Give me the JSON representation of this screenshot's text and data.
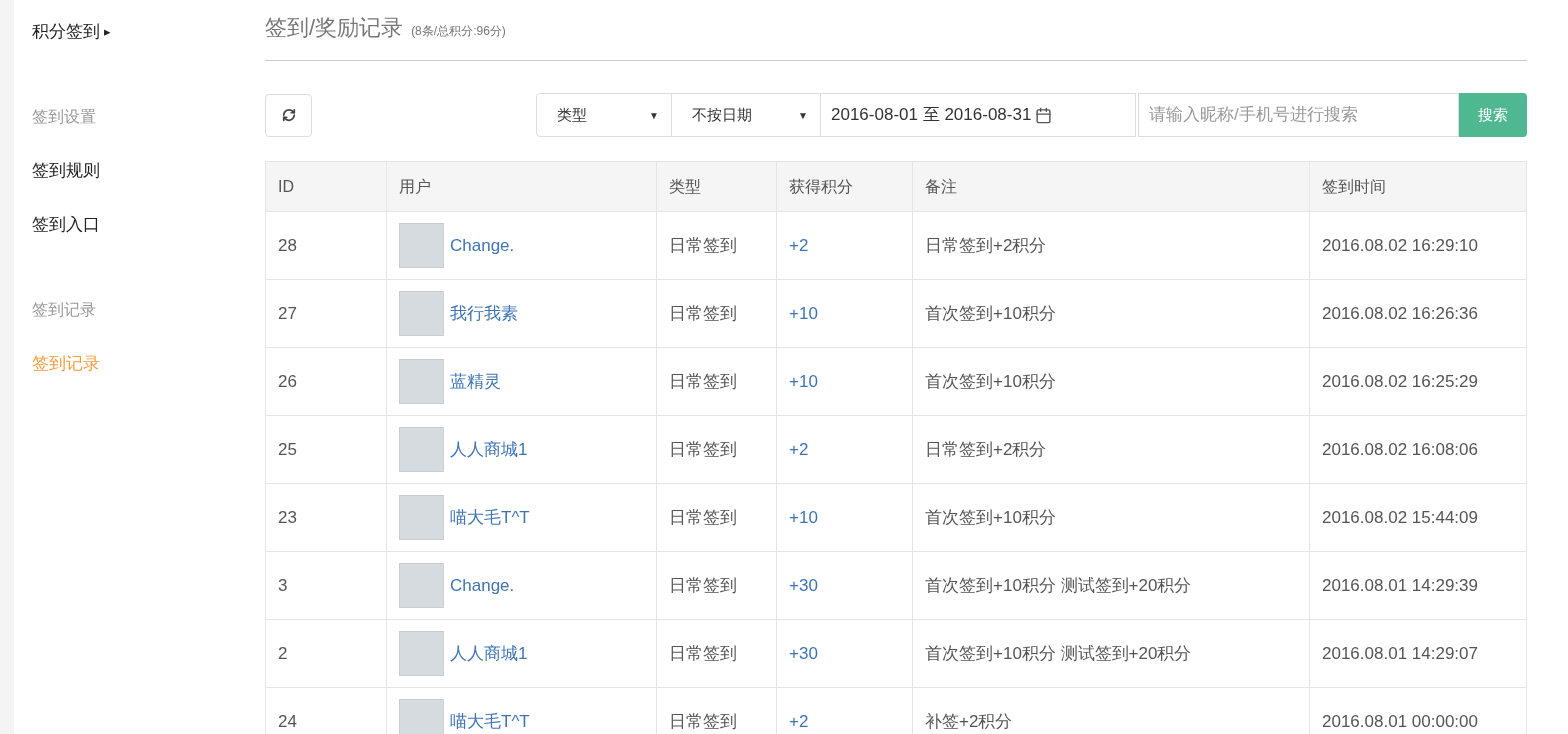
{
  "sidebar": {
    "title": "积分签到",
    "title_icon": "▸",
    "groups": [
      {
        "label": "签到设置",
        "items": [
          {
            "label": "签到规则",
            "selected": false
          },
          {
            "label": "签到入口",
            "selected": false
          }
        ]
      },
      {
        "label": "签到记录",
        "items": [
          {
            "label": "签到记录",
            "selected": true
          }
        ]
      }
    ]
  },
  "page": {
    "title": "签到/奖励记录",
    "summary": "(8条/总积分:96分)"
  },
  "toolbar": {
    "type_select": "类型",
    "type_caret": "▼",
    "date_select": "不按日期",
    "date_caret": "▼",
    "date_range": "2016-08-01 至 2016-08-31",
    "search": {
      "placeholder": "请输入昵称/手机号进行搜索"
    },
    "search_button": "搜索"
  },
  "table": {
    "columns": [
      "ID",
      "用户",
      "类型",
      "获得积分",
      "备注",
      "签到时间"
    ],
    "rows": [
      {
        "id": "28",
        "user": "Change.",
        "type": "日常签到",
        "points": "+2",
        "note": "日常签到+2积分",
        "time": "2016.08.02 16:29:10"
      },
      {
        "id": "27",
        "user": "我行我素",
        "type": "日常签到",
        "points": "+10",
        "note": "首次签到+10积分",
        "time": "2016.08.02 16:26:36"
      },
      {
        "id": "26",
        "user": "蓝精灵",
        "type": "日常签到",
        "points": "+10",
        "note": "首次签到+10积分",
        "time": "2016.08.02 16:25:29"
      },
      {
        "id": "25",
        "user": "人人商城1",
        "type": "日常签到",
        "points": "+2",
        "note": "日常签到+2积分",
        "time": "2016.08.02 16:08:06"
      },
      {
        "id": "23",
        "user": "喵大毛T^T",
        "type": "日常签到",
        "points": "+10",
        "note": "首次签到+10积分",
        "time": "2016.08.02 15:44:09"
      },
      {
        "id": "3",
        "user": "Change.",
        "type": "日常签到",
        "points": "+30",
        "note": "首次签到+10积分 测试签到+20积分",
        "time": "2016.08.01 14:29:39"
      },
      {
        "id": "2",
        "user": "人人商城1",
        "type": "日常签到",
        "points": "+30",
        "note": "首次签到+10积分 测试签到+20积分",
        "time": "2016.08.01 14:29:07"
      },
      {
        "id": "24",
        "user": "喵大毛T^T",
        "type": "日常签到",
        "points": "+2",
        "note": "补签+2积分",
        "time": "2016.08.01 00:00:00"
      }
    ]
  }
}
